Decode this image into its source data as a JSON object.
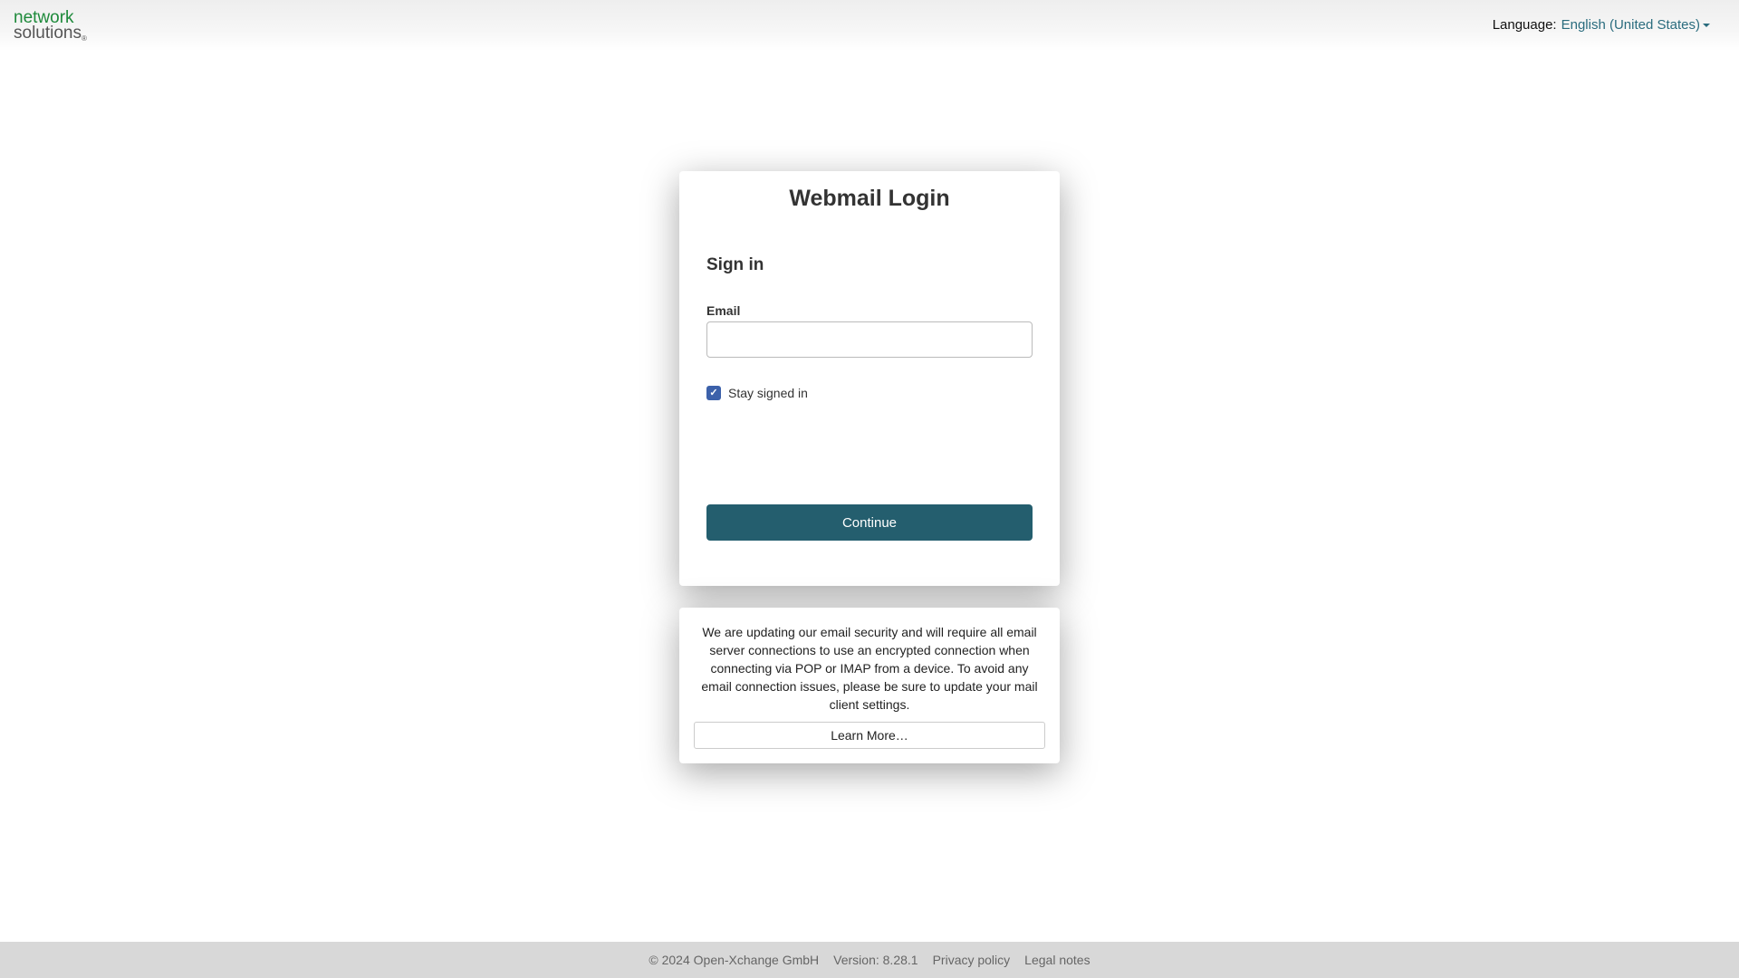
{
  "header": {
    "logo": {
      "line1": "network",
      "line2": "solutions",
      "mark": "®"
    },
    "language": {
      "label": "Language:",
      "value": "English (United States)"
    }
  },
  "login": {
    "title": "Webmail Login",
    "heading": "Sign in",
    "email_label": "Email",
    "email_value": "",
    "stay_signed_in_label": "Stay signed in",
    "stay_signed_in_checked": true,
    "continue_label": "Continue"
  },
  "notice": {
    "text": "We are updating our email security and will require all email server connections to use an encrypted connection when connecting via POP or IMAP from a device. To avoid any email connection issues, please be sure to update your mail client settings.",
    "learn_more_label": "Learn More…"
  },
  "footer": {
    "copyright": "© 2024 Open-Xchange GmbH",
    "version": "Version: 8.28.1",
    "privacy": "Privacy policy",
    "legal": "Legal notes"
  },
  "colors": {
    "brand_green": "#1e8a3b",
    "link_teal": "#2a6c7e",
    "primary_button": "#245e6e",
    "checkbox_blue": "#3c61aa"
  },
  "icons": {
    "checkbox": "check-icon",
    "language_dropdown": "caret-down-icon"
  }
}
